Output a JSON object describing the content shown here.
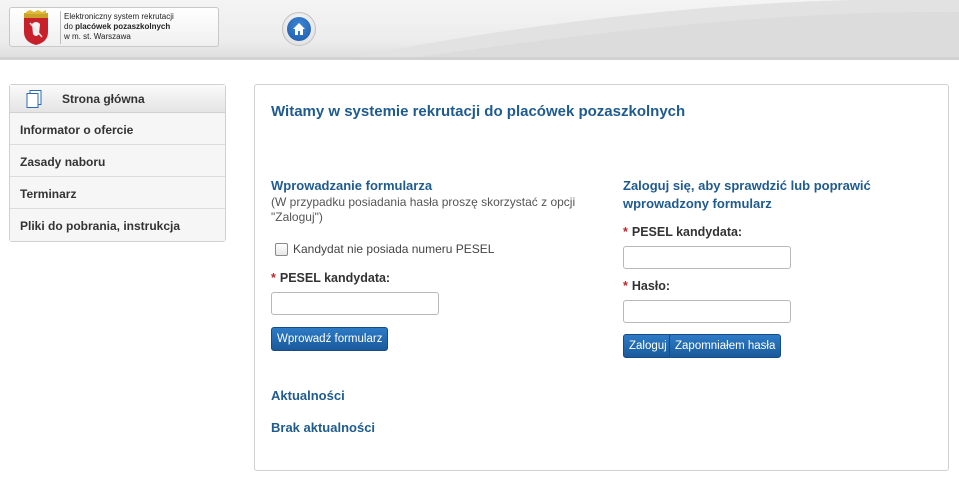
{
  "header": {
    "logo_line1": "Elektroniczny system rekrutacji",
    "logo_line2_prefix": "do ",
    "logo_line2_bold": "placówek pozaszkolnych",
    "logo_line3": "w m. st. Warszawa"
  },
  "sidebar": {
    "head_label": "Strona główna",
    "items": [
      {
        "label": "Informator o ofercie"
      },
      {
        "label": "Zasady naboru"
      },
      {
        "label": "Terminarz"
      },
      {
        "label": "Pliki do pobrania, instrukcja"
      }
    ]
  },
  "main": {
    "title": "Witamy w systemie rekrutacji do placówek pozaszkolnych",
    "form": {
      "title": "Wprowadzanie formularza",
      "note": "(W przypadku posiadania hasła proszę skorzystać z opcji \"Zaloguj\")",
      "checkbox_label": "Kandydat nie posiada numeru PESEL",
      "required_mark": "*",
      "pesel_label": "PESEL kandydata:",
      "pesel_value": "",
      "submit_label": "Wprowadź formularz"
    },
    "login": {
      "title": "Zaloguj się, aby sprawdzić lub poprawić wprowadzony formularz",
      "required_mark": "*",
      "pesel_label": "PESEL kandydata:",
      "pesel_value": "",
      "password_label": "Hasło:",
      "password_value": "",
      "login_label": "Zaloguj",
      "forgot_label": "Zapomniałem hasła"
    },
    "news": {
      "title": "Aktualności",
      "empty_text": "Brak aktualności"
    }
  },
  "colors": {
    "accent": "#1f5b8f",
    "button": "#1a5a9c",
    "required": "#c0262d"
  },
  "icons": [
    "crest-icon",
    "home-icon",
    "document-icon"
  ]
}
